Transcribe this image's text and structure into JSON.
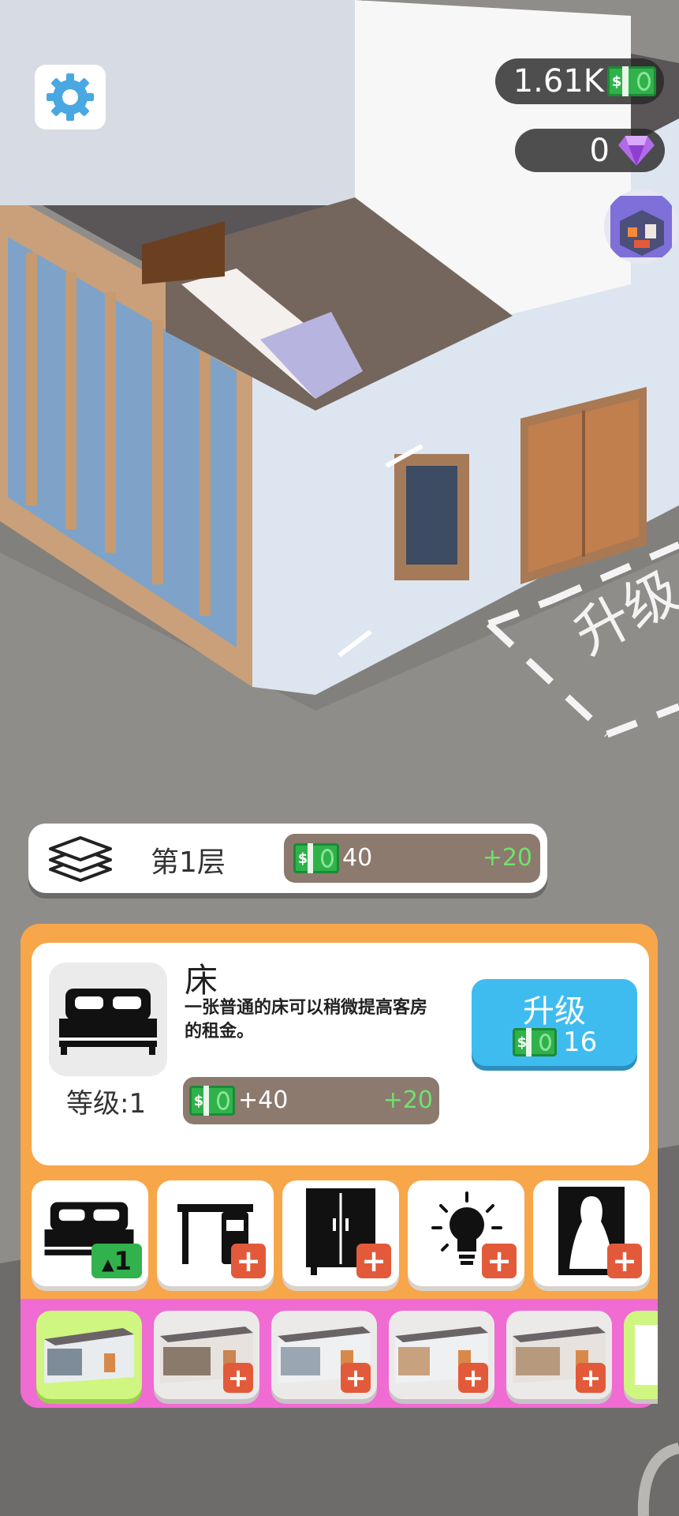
{
  "hud": {
    "cash": "1.61K",
    "gems": "0"
  },
  "scene": {
    "ground_label": "升级"
  },
  "floor_bar": {
    "label": "第1层",
    "income": "40",
    "bonus": "+20"
  },
  "item_panel": {
    "name": "床",
    "description_line1": "一张普通的床可以稍微提高客房",
    "description_line2": "的租金。",
    "level": "等级:1",
    "income": "+40",
    "bonus": "+20",
    "upgrade_label": "升级",
    "upgrade_cost": "16"
  },
  "furniture_slots": [
    {
      "name": "bed",
      "badge": "1"
    },
    {
      "name": "desk"
    },
    {
      "name": "wardrobe"
    },
    {
      "name": "lamp"
    },
    {
      "name": "mirror"
    }
  ],
  "colors": {
    "panel_orange": "#f8a64a",
    "strip_pink": "#f06bd2",
    "upgrade_blue": "#3fbcef",
    "cash_green": "#2fb24a",
    "bonus_green": "#6ee36b"
  }
}
